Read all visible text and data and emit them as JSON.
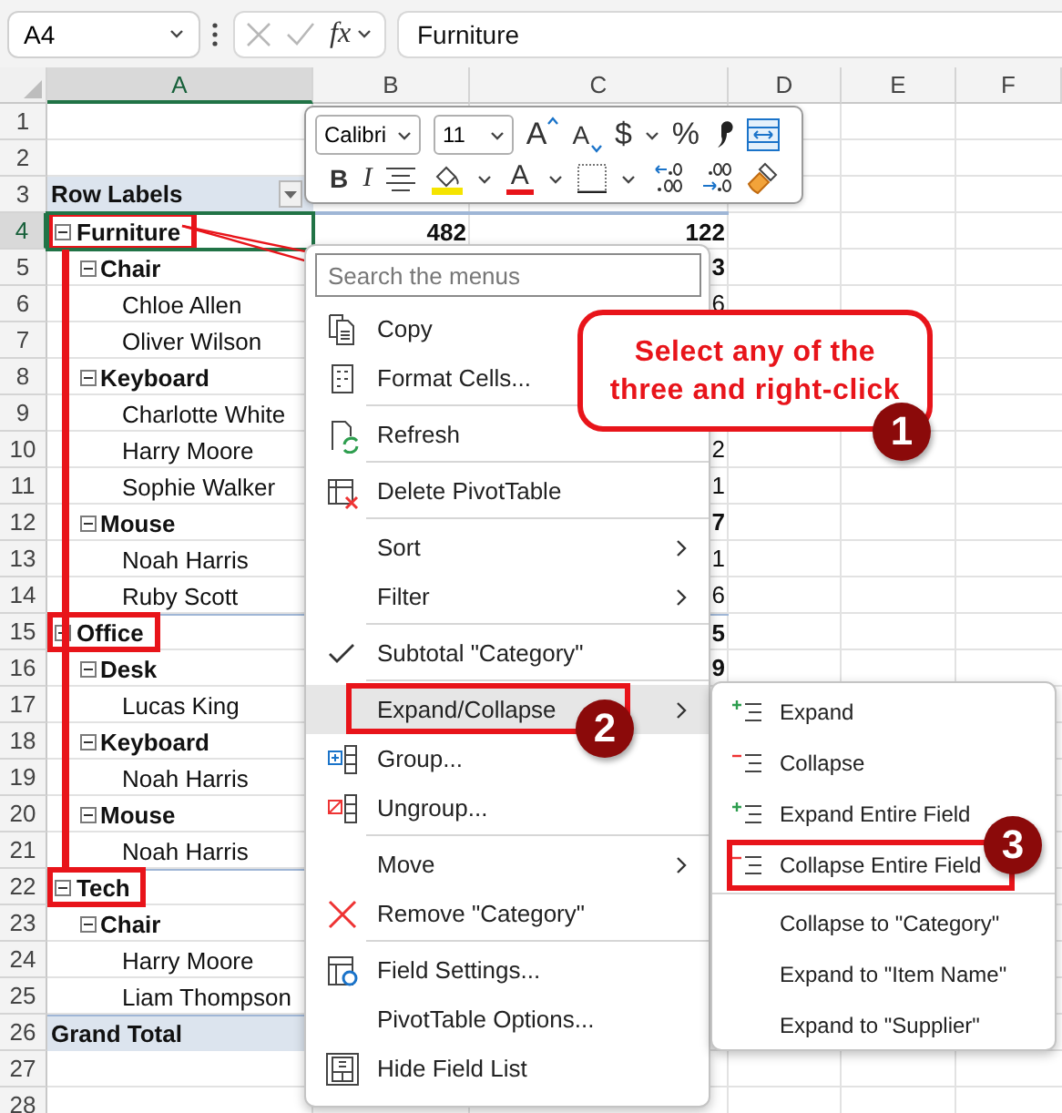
{
  "formula_bar": {
    "name_box": "A4",
    "function_label": "fx",
    "formula": "Furniture"
  },
  "columns": [
    {
      "label": "A",
      "selected": true
    },
    {
      "label": "B",
      "selected": false
    },
    {
      "label": "C",
      "selected": false
    },
    {
      "label": "D",
      "selected": false
    },
    {
      "label": "E",
      "selected": false
    },
    {
      "label": "F",
      "selected": false
    }
  ],
  "row_numbers": [
    {
      "label": "1",
      "selected": false
    },
    {
      "label": "2",
      "selected": false
    },
    {
      "label": "3",
      "selected": false
    },
    {
      "label": "4",
      "selected": true
    },
    {
      "label": "5",
      "selected": false
    },
    {
      "label": "6",
      "selected": false
    },
    {
      "label": "7",
      "selected": false
    },
    {
      "label": "8",
      "selected": false
    },
    {
      "label": "9",
      "selected": false
    },
    {
      "label": "10",
      "selected": false
    },
    {
      "label": "11",
      "selected": false
    },
    {
      "label": "12",
      "selected": false
    },
    {
      "label": "13",
      "selected": false
    },
    {
      "label": "14",
      "selected": false
    },
    {
      "label": "15",
      "selected": false
    },
    {
      "label": "16",
      "selected": false
    },
    {
      "label": "17",
      "selected": false
    },
    {
      "label": "18",
      "selected": false
    },
    {
      "label": "19",
      "selected": false
    },
    {
      "label": "20",
      "selected": false
    },
    {
      "label": "21",
      "selected": false
    },
    {
      "label": "22",
      "selected": false
    },
    {
      "label": "23",
      "selected": false
    },
    {
      "label": "24",
      "selected": false
    },
    {
      "label": "25",
      "selected": false
    },
    {
      "label": "26",
      "selected": false
    },
    {
      "label": "27",
      "selected": false
    },
    {
      "label": "28",
      "selected": false
    }
  ],
  "pivot": {
    "header": "Row Labels",
    "grand_total": "Grand Total",
    "rows": [
      {
        "label": "Furniture",
        "expanded": true,
        "selected": true,
        "highlighted": true,
        "col_b": "482",
        "col_c": "122",
        "children": [
          {
            "label": "Chair",
            "expanded": true,
            "selected": false,
            "col_c": "3",
            "children": [
              {
                "label": "Chloe Allen",
                "selected": false,
                "col_c": "6"
              },
              {
                "label": "Oliver Wilson",
                "selected": false
              }
            ]
          },
          {
            "label": "Keyboard",
            "expanded": true,
            "selected": false,
            "children": [
              {
                "label": "Charlotte White",
                "selected": false
              },
              {
                "label": "Harry Moore",
                "selected": false,
                "col_c": "2"
              },
              {
                "label": "Sophie Walker",
                "selected": false,
                "col_c": "1"
              }
            ]
          },
          {
            "label": "Mouse",
            "expanded": true,
            "selected": false,
            "col_c": "7",
            "children": [
              {
                "label": "Noah Harris",
                "selected": false,
                "col_c": "1"
              },
              {
                "label": "Ruby Scott",
                "selected": false,
                "col_c": "6"
              }
            ]
          }
        ]
      },
      {
        "label": "Office",
        "expanded": true,
        "selected": false,
        "highlighted": true,
        "col_c": "5",
        "children": [
          {
            "label": "Desk",
            "expanded": true,
            "selected": false,
            "col_c": "9",
            "children": [
              {
                "label": "Lucas King",
                "selected": false
              }
            ]
          },
          {
            "label": "Keyboard",
            "expanded": true,
            "selected": false,
            "children": [
              {
                "label": "Noah Harris",
                "selected": false
              }
            ]
          },
          {
            "label": "Mouse",
            "expanded": true,
            "selected": false,
            "children": [
              {
                "label": "Noah Harris",
                "selected": false
              }
            ]
          }
        ]
      },
      {
        "label": "Tech",
        "expanded": true,
        "selected": false,
        "highlighted": true,
        "children": [
          {
            "label": "Chair",
            "expanded": true,
            "selected": false,
            "children": [
              {
                "label": "Harry Moore",
                "selected": false
              },
              {
                "label": "Liam Thompson",
                "selected": false
              }
            ]
          }
        ]
      }
    ]
  },
  "mini_toolbar": {
    "row_1": [
      {
        "kind": "font",
        "value": "Calibri"
      },
      {
        "kind": "size",
        "value": "11"
      },
      {
        "kind": "grow",
        "label": "A"
      },
      {
        "kind": "shrink",
        "label": "A"
      },
      {
        "kind": "symbol",
        "label": "$"
      },
      {
        "kind": "caret"
      },
      {
        "kind": "symbol",
        "label": "%"
      },
      {
        "kind": "comma"
      },
      {
        "kind": "wrap"
      }
    ],
    "row_2": [
      {
        "kind": "bold",
        "label": "B"
      },
      {
        "kind": "italic",
        "label": "I"
      },
      {
        "kind": "align"
      },
      {
        "kind": "fill"
      },
      {
        "kind": "caret"
      },
      {
        "kind": "font_color",
        "label": "A"
      },
      {
        "kind": "caret"
      },
      {
        "kind": "borders"
      },
      {
        "kind": "caret"
      },
      {
        "kind": "inc_decimal"
      },
      {
        "kind": "dec_decimal"
      },
      {
        "kind": "painter"
      }
    ]
  },
  "context_menu": {
    "search_placeholder": "Search the menus",
    "groups": [
      [
        {
          "label": "Copy",
          "selected": false,
          "checked": false,
          "submenu": false,
          "highlighted": false
        },
        {
          "label": "Format Cells...",
          "selected": false,
          "checked": false,
          "submenu": false,
          "highlighted": false
        }
      ],
      [
        {
          "label": "Refresh",
          "selected": false,
          "checked": false,
          "submenu": false,
          "highlighted": false
        }
      ],
      [
        {
          "label": "Delete PivotTable",
          "selected": false,
          "checked": false,
          "submenu": false,
          "highlighted": false
        }
      ],
      [
        {
          "label": "Sort",
          "selected": false,
          "checked": false,
          "submenu": true,
          "highlighted": false
        },
        {
          "label": "Filter",
          "selected": false,
          "checked": false,
          "submenu": true,
          "highlighted": false
        }
      ],
      [
        {
          "label": "Subtotal \"Category\"",
          "selected": false,
          "checked": true,
          "submenu": false,
          "highlighted": false
        }
      ],
      [
        {
          "label": "Expand/Collapse",
          "selected": true,
          "checked": false,
          "submenu": true,
          "highlighted": true
        },
        {
          "label": "Group...",
          "selected": false,
          "checked": false,
          "submenu": false,
          "highlighted": false
        },
        {
          "label": "Ungroup...",
          "selected": false,
          "checked": false,
          "submenu": false,
          "highlighted": false
        }
      ],
      [
        {
          "label": "Move",
          "selected": false,
          "checked": false,
          "submenu": true,
          "highlighted": false
        },
        {
          "label": "Remove \"Category\"",
          "selected": false,
          "checked": false,
          "submenu": false,
          "highlighted": false
        }
      ],
      [
        {
          "label": "Field Settings...",
          "selected": false,
          "checked": false,
          "submenu": false,
          "highlighted": false
        },
        {
          "label": "PivotTable Options...",
          "selected": false,
          "checked": false,
          "submenu": false,
          "highlighted": false
        },
        {
          "label": "Hide Field List",
          "selected": false,
          "checked": false,
          "submenu": false,
          "highlighted": false
        }
      ]
    ]
  },
  "submenu": {
    "groups": [
      [
        {
          "label": "Expand",
          "selected": false,
          "highlighted": false
        },
        {
          "label": "Collapse",
          "selected": false,
          "highlighted": false
        },
        {
          "label": "Expand Entire Field",
          "selected": false,
          "highlighted": false
        },
        {
          "label": "Collapse Entire Field",
          "selected": false,
          "highlighted": true
        }
      ],
      [
        {
          "label": "Collapse to \"Category\"",
          "selected": false,
          "highlighted": false
        },
        {
          "label": "Expand to \"Item Name\"",
          "selected": false,
          "highlighted": false
        },
        {
          "label": "Expand to \"Supplier\"",
          "selected": false,
          "highlighted": false
        }
      ]
    ]
  },
  "annotations": {
    "callout": "Select any of the three and right-click",
    "badges": [
      "1",
      "2",
      "3"
    ]
  }
}
